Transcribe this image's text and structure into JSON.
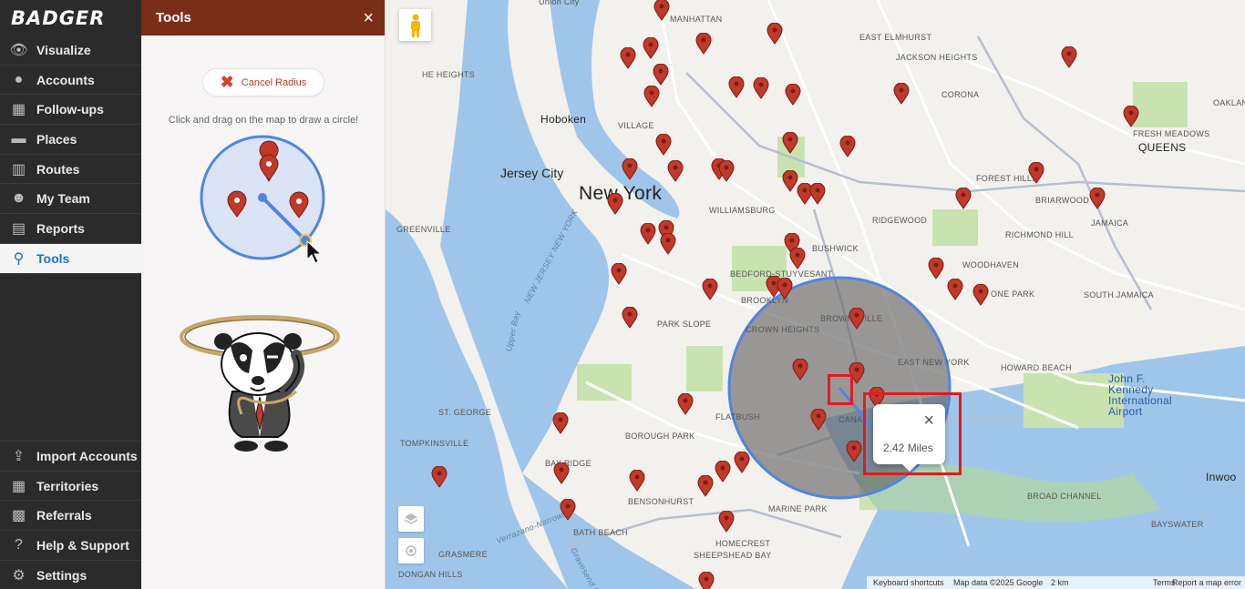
{
  "brand": {
    "name": "BADGER"
  },
  "nav": {
    "top": [
      {
        "label": "Visualize",
        "icon": "eye-icon"
      },
      {
        "label": "Accounts",
        "icon": "user-icon"
      },
      {
        "label": "Follow-ups",
        "icon": "calendar-icon"
      },
      {
        "label": "Places",
        "icon": "store-icon"
      },
      {
        "label": "Routes",
        "icon": "map-icon"
      },
      {
        "label": "My Team",
        "icon": "team-icon"
      },
      {
        "label": "Reports",
        "icon": "chart-icon"
      },
      {
        "label": "Tools",
        "icon": "lasso-icon",
        "active": true
      }
    ],
    "bottom": [
      {
        "label": "Import Accounts",
        "icon": "upload-icon"
      },
      {
        "label": "Territories",
        "icon": "grid-icon"
      },
      {
        "label": "Referrals",
        "icon": "gift-icon"
      },
      {
        "label": "Help & Support",
        "icon": "question-icon"
      },
      {
        "label": "Settings",
        "icon": "gear-icon"
      }
    ]
  },
  "tools": {
    "title": "Tools",
    "close": "×",
    "cancel_label": "Cancel Radius",
    "hint": "Click and drag on the map to draw a circle!"
  },
  "map": {
    "labels": {
      "union_city": "Union City",
      "manhattan": "MANHATTAN",
      "heights": "HE HEIGHTS",
      "hoboken": "Hoboken",
      "village": "VILLAGE",
      "jersey_city": "Jersey City",
      "new_york": "New York",
      "williamsburg": "WILLIAMSBURG",
      "greenville": "GREENVILLE",
      "bushwick": "BUSHWICK",
      "ridgewood": "RIDGEWOOD",
      "bedford": "BEDFORD-STUYVESANT",
      "brooklyn": "BROOKLYN",
      "park_slope": "PARK SLOPE",
      "crown_heights": "CROWN HEIGHTS",
      "brownsville": "BROWNSVILLE",
      "east_new_york": "EAST NEW YORK",
      "upper_bay": "Upper Bay",
      "nj_ny": "NEW JERSEY NEW YORK",
      "st_george": "ST. GEORGE",
      "flatbush": "FLATBUSH",
      "canarsie": "CANA",
      "tompkinsville": "TOMPKINSVILLE",
      "borough_park": "BOROUGH PARK",
      "bay_ridge": "BAY RIDGE",
      "bensonhurst": "BENSONHURST",
      "marine_park": "MARINE PARK",
      "bath_beach": "BATH BEACH",
      "homecrest": "HOMECREST",
      "sheepshead": "SHEEPSHEAD BAY",
      "grasmere": "GRASMERE",
      "dongan": "DONGAN HILLS",
      "jackson_heights": "JACKSON HEIGHTS",
      "east_elmhurst": "EAST ELMHURST",
      "corona": "CORONA",
      "queens": "QUEENS",
      "fresh_meadows": "FRESH MEADOWS",
      "oakland_gardens": "OAKLAND GARDENS",
      "forest_hills": "FOREST HILLS",
      "briarwood": "BRIARWOOD",
      "jamaica": "JAMAICA",
      "richmond_hill": "RICHMOND HILL",
      "woodhaven": "WOODHAVEN",
      "ozone_park": "ONE PARK",
      "south_jamaica": "SOUTH JAMAICA",
      "howard_beach": "HOWARD BEACH",
      "jfk": "John F. Kennedy International Airport",
      "inwood": "Inwoo",
      "broad_channel": "BROAD CHANNEL",
      "bayswater": "BAYSWATER",
      "gravesend": "Gravesend Bay",
      "verrazano": "Verrazano-Narrows"
    },
    "info_window": {
      "text": "2.42 Miles",
      "close": "×"
    },
    "footer": {
      "shortcuts": "Keyboard shortcuts",
      "data": "Map data ©2025 Google",
      "scale": "2 km",
      "terms": "Terms",
      "report": "Report a map error"
    },
    "colors": {
      "circle_fill": "#5f5f5f",
      "circle_stroke": "#4f86e0",
      "pin": "#c0392b",
      "highlight": "#e01b22"
    }
  }
}
